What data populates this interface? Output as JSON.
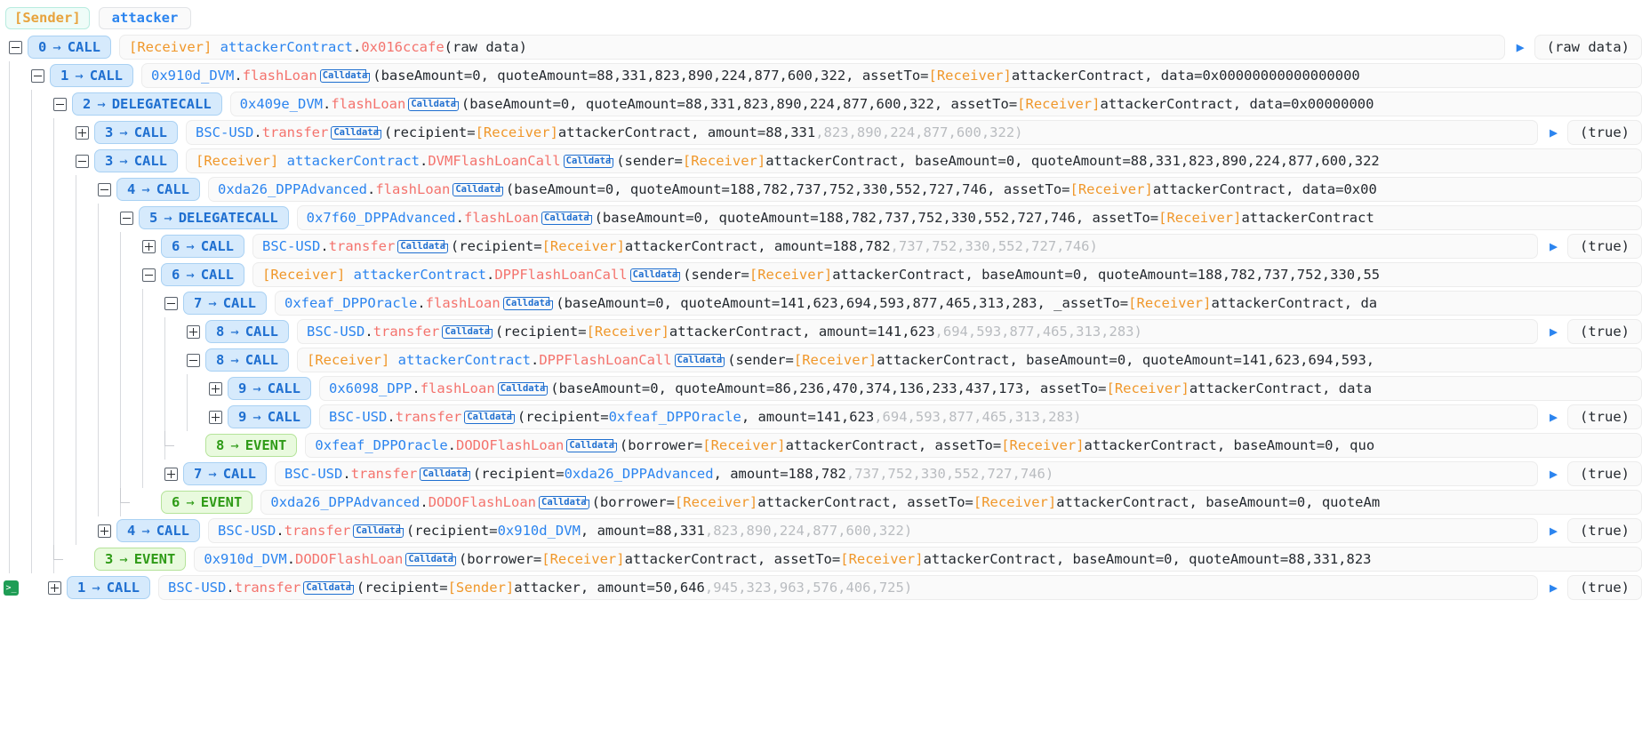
{
  "header": {
    "sender_tag": "[Sender]",
    "actor": "attacker"
  },
  "labels": {
    "calldata": "Calldata",
    "arrow": "→",
    "return_arrow": "▶",
    "raw_data": "(raw data)",
    "true_value": "(true)",
    "terminal_icon": "terminal-icon"
  },
  "colors": {
    "call_badge_bg": "#d6eafc",
    "call_badge_border": "#a9d1f3",
    "call_badge_text": "#1f6fd0",
    "event_badge_bg": "#e9fade",
    "event_badge_border": "#b5e39a",
    "event_badge_text": "#2f9b17",
    "address": "#2b84ef",
    "function": "#f4736d",
    "receiver_tag": "#f0972a",
    "sender_tag": "#e8a33d",
    "dim_digits": "#b9bcc0",
    "pill_bg": "#fafafa"
  },
  "rows": [
    {
      "depth": 0,
      "toggle": "minus",
      "kind": "CALL",
      "index": "0",
      "label": "CALL",
      "target_tag": "[Receiver]",
      "target": "attackerContract",
      "fn": "0x016ccafe",
      "calldata": false,
      "args": "(raw data)",
      "args_dim": "",
      "args_tail": "",
      "has_return": true,
      "return_value": "(raw data)"
    },
    {
      "depth": 1,
      "toggle": "minus",
      "kind": "CALL",
      "index": "1",
      "label": "CALL",
      "target_tag": "",
      "target": "0x910d_DVM",
      "fn": "flashLoan",
      "calldata": true,
      "args": "(baseAmount=0, quoteAmount=88,331,823,890,224,877,600,322, assetTo=",
      "args_tag": "[Receiver]",
      "args_tail": "attackerContract, data=0x00000000000000000",
      "has_return": false,
      "return_value": ""
    },
    {
      "depth": 2,
      "toggle": "minus",
      "kind": "CALL",
      "index": "2",
      "label": "DELEGATECALL",
      "target_tag": "",
      "target": "0x409e_DVM",
      "fn": "flashLoan",
      "calldata": true,
      "args": "(baseAmount=0, quoteAmount=88,331,823,890,224,877,600,322, assetTo=",
      "args_tag": "[Receiver]",
      "args_tail": "attackerContract, data=0x00000000",
      "has_return": false,
      "return_value": ""
    },
    {
      "depth": 3,
      "toggle": "plus",
      "kind": "CALL",
      "index": "3",
      "label": "CALL",
      "target_tag": "",
      "target": "BSC-USD",
      "fn": "transfer",
      "calldata": true,
      "args": "(recipient=",
      "args_tag": "[Receiver]",
      "args_tail": "attackerContract, amount=88,331",
      "args_dim": ",823,890,224,877,600,322)",
      "has_return": true,
      "return_value": "(true)"
    },
    {
      "depth": 3,
      "toggle": "minus",
      "kind": "CALL",
      "index": "3",
      "label": "CALL",
      "target_tag": "[Receiver]",
      "target": "attackerContract",
      "fn": "DVMFlashLoanCall",
      "calldata": true,
      "args": "(sender=",
      "args_tag": "[Receiver]",
      "args_tail": "attackerContract, baseAmount=0, quoteAmount=88,331,823,890,224,877,600,322",
      "has_return": false,
      "return_value": ""
    },
    {
      "depth": 4,
      "toggle": "minus",
      "kind": "CALL",
      "index": "4",
      "label": "CALL",
      "target_tag": "",
      "target": "0xda26_DPPAdvanced",
      "fn": "flashLoan",
      "calldata": true,
      "args": "(baseAmount=0, quoteAmount=188,782,737,752,330,552,727,746, assetTo=",
      "args_tag": "[Receiver]",
      "args_tail": "attackerContract, data=0x00",
      "has_return": false,
      "return_value": ""
    },
    {
      "depth": 5,
      "toggle": "minus",
      "kind": "CALL",
      "index": "5",
      "label": "DELEGATECALL",
      "target_tag": "",
      "target": "0x7f60_DPPAdvanced",
      "fn": "flashLoan",
      "calldata": true,
      "args": "(baseAmount=0, quoteAmount=188,782,737,752,330,552,727,746, assetTo=",
      "args_tag": "[Receiver]",
      "args_tail": "attackerContract",
      "has_return": false,
      "return_value": ""
    },
    {
      "depth": 6,
      "toggle": "plus",
      "kind": "CALL",
      "index": "6",
      "label": "CALL",
      "target_tag": "",
      "target": "BSC-USD",
      "fn": "transfer",
      "calldata": true,
      "args": "(recipient=",
      "args_tag": "[Receiver]",
      "args_tail": "attackerContract, amount=188,782",
      "args_dim": ",737,752,330,552,727,746)",
      "has_return": true,
      "return_value": "(true)"
    },
    {
      "depth": 6,
      "toggle": "minus",
      "kind": "CALL",
      "index": "6",
      "label": "CALL",
      "target_tag": "[Receiver]",
      "target": "attackerContract",
      "fn": "DPPFlashLoanCall",
      "calldata": true,
      "args": "(sender=",
      "args_tag": "[Receiver]",
      "args_tail": "attackerContract, baseAmount=0, quoteAmount=188,782,737,752,330,55",
      "has_return": false,
      "return_value": ""
    },
    {
      "depth": 7,
      "toggle": "minus",
      "kind": "CALL",
      "index": "7",
      "label": "CALL",
      "target_tag": "",
      "target": "0xfeaf_DPPOracle",
      "fn": "flashLoan",
      "calldata": true,
      "args": "(baseAmount=0, quoteAmount=141,623,694,593,877,465,313,283, _assetTo=",
      "args_tag": "[Receiver]",
      "args_tail": "attackerContract, da",
      "has_return": false,
      "return_value": ""
    },
    {
      "depth": 8,
      "toggle": "plus",
      "kind": "CALL",
      "index": "8",
      "label": "CALL",
      "target_tag": "",
      "target": "BSC-USD",
      "fn": "transfer",
      "calldata": true,
      "args": "(recipient=",
      "args_tag": "[Receiver]",
      "args_tail": "attackerContract, amount=141,623",
      "args_dim": ",694,593,877,465,313,283)",
      "has_return": true,
      "return_value": "(true)"
    },
    {
      "depth": 8,
      "toggle": "minus",
      "kind": "CALL",
      "index": "8",
      "label": "CALL",
      "target_tag": "[Receiver]",
      "target": "attackerContract",
      "fn": "DPPFlashLoanCall",
      "calldata": true,
      "args": "(sender=",
      "args_tag": "[Receiver]",
      "args_tail": "attackerContract, baseAmount=0, quoteAmount=141,623,694,593, ",
      "has_return": false,
      "return_value": ""
    },
    {
      "depth": 9,
      "toggle": "plus",
      "kind": "CALL",
      "index": "9",
      "label": "CALL",
      "target_tag": "",
      "target": "0x6098_DPP",
      "fn": "flashLoan",
      "calldata": true,
      "args": "(baseAmount=0, quoteAmount=86,236,470,374,136,233,437,173, assetTo=",
      "args_tag": "[Receiver]",
      "args_tail": "attackerContract, data",
      "has_return": false,
      "return_value": ""
    },
    {
      "depth": 9,
      "toggle": "plus",
      "kind": "CALL",
      "index": "9",
      "label": "CALL",
      "target_tag": "",
      "target": "BSC-USD",
      "fn": "transfer",
      "calldata": true,
      "args": "(recipient=",
      "args_addr": "0xfeaf_DPPOracle",
      "args_tail": ", amount=141,623",
      "args_dim": ",694,593,877,465,313,283)",
      "has_return": true,
      "return_value": "(true)"
    },
    {
      "depth": 8,
      "toggle": "none",
      "kind": "EVENT",
      "index": "8",
      "label": "EVENT",
      "target_tag": "",
      "target": "0xfeaf_DPPOracle",
      "fn": "DODOFlashLoan",
      "calldata": true,
      "args": "(borrower=",
      "args_tag": "[Receiver]",
      "args_tail": "attackerContract, assetTo=",
      "args_tag2": "[Receiver]",
      "args_tail2": "attackerContract, baseAmount=0, quo",
      "has_return": false,
      "return_value": ""
    },
    {
      "depth": 7,
      "toggle": "plus",
      "kind": "CALL",
      "index": "7",
      "label": "CALL",
      "target_tag": "",
      "target": "BSC-USD",
      "fn": "transfer",
      "calldata": true,
      "args": "(recipient=",
      "args_addr": "0xda26_DPPAdvanced",
      "args_tail": ", amount=188,782",
      "args_dim": ",737,752,330,552,727,746)",
      "has_return": true,
      "return_value": "(true)"
    },
    {
      "depth": 6,
      "toggle": "none",
      "kind": "EVENT",
      "index": "6",
      "label": "EVENT",
      "target_tag": "",
      "target": "0xda26_DPPAdvanced",
      "fn": "DODOFlashLoan",
      "calldata": true,
      "args": "(borrower=",
      "args_tag": "[Receiver]",
      "args_tail": "attackerContract, assetTo=",
      "args_tag2": "[Receiver]",
      "args_tail2": "attackerContract, baseAmount=0, quoteAm",
      "has_return": false,
      "return_value": ""
    },
    {
      "depth": 4,
      "toggle": "plus",
      "kind": "CALL",
      "index": "4",
      "label": "CALL",
      "target_tag": "",
      "target": "BSC-USD",
      "fn": "transfer",
      "calldata": true,
      "args": "(recipient=",
      "args_addr": "0x910d_DVM",
      "args_tail": ", amount=88,331",
      "args_dim": ",823,890,224,877,600,322)",
      "has_return": true,
      "return_value": "(true)"
    },
    {
      "depth": 3,
      "toggle": "none",
      "kind": "EVENT",
      "index": "3",
      "label": "EVENT",
      "target_tag": "",
      "target": "0x910d_DVM",
      "fn": "DODOFlashLoan",
      "calldata": true,
      "args": "(borrower=",
      "args_tag": "[Receiver]",
      "args_tail": "attackerContract, assetTo=",
      "args_tag2": "[Receiver]",
      "args_tail2": "attackerContract, baseAmount=0, quoteAmount=88,331,823",
      "has_return": false,
      "return_value": ""
    },
    {
      "depth": 0,
      "terminal": true,
      "toggle": "plus",
      "kind": "CALL",
      "index": "1",
      "label": "CALL",
      "target_tag": "",
      "target": "BSC-USD",
      "fn": "transfer",
      "calldata": true,
      "args": "(recipient=",
      "args_tag": "[Sender]",
      "args_tail": "attacker, amount=50,646",
      "args_dim": ",945,323,963,576,406,725)",
      "has_return": true,
      "return_value": "(true)"
    }
  ]
}
